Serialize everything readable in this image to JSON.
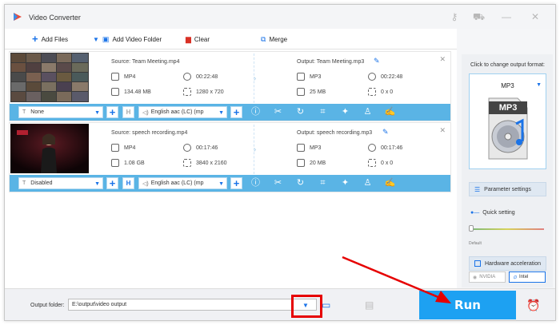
{
  "window": {
    "title": "Video Converter"
  },
  "toolbar": {
    "add_files": "Add Files",
    "add_video_folder": "Add Video Folder",
    "clear": "Clear",
    "merge": "Merge"
  },
  "files": [
    {
      "source": "Source: Team Meeting.mp4",
      "src_format": "MP4",
      "src_duration": "00:22:48",
      "src_size": "134.48 MB",
      "src_resolution": "1280 x 720",
      "output": "Output: Team Meeting.mp3",
      "out_format": "MP3",
      "out_duration": "00:22:48",
      "out_size": "25 MB",
      "out_resolution": "0 x 0",
      "subtitle": "None",
      "audio": "English aac (LC) (mp"
    },
    {
      "source": "Source: speech recording.mp4",
      "src_format": "MP4",
      "src_duration": "00:17:46",
      "src_size": "1.08 GB",
      "src_resolution": "3840 x 2160",
      "output": "Output: speech recording.mp3",
      "out_format": "MP3",
      "out_duration": "00:17:46",
      "out_size": "20 MB",
      "out_resolution": "0 x 0",
      "subtitle": "Disabled",
      "audio": "English aac (LC) (mp"
    }
  ],
  "right_panel": {
    "title": "Click to change output format:",
    "format": "MP3",
    "card_label": "MP3",
    "parameter_settings": "Parameter settings",
    "quick_setting": "Quick setting",
    "default_label": "Default",
    "hw_accel": "Hardware acceleration",
    "nvidia": "NVIDIA",
    "intel": "Intel"
  },
  "bottom": {
    "output_folder_label": "Output folder:",
    "output_folder_value": "E:\\output\\video output",
    "run": "Run"
  },
  "colors": {
    "accent": "#1da1f2",
    "bar": "#5ab4e5",
    "highlight": "#e60000"
  }
}
